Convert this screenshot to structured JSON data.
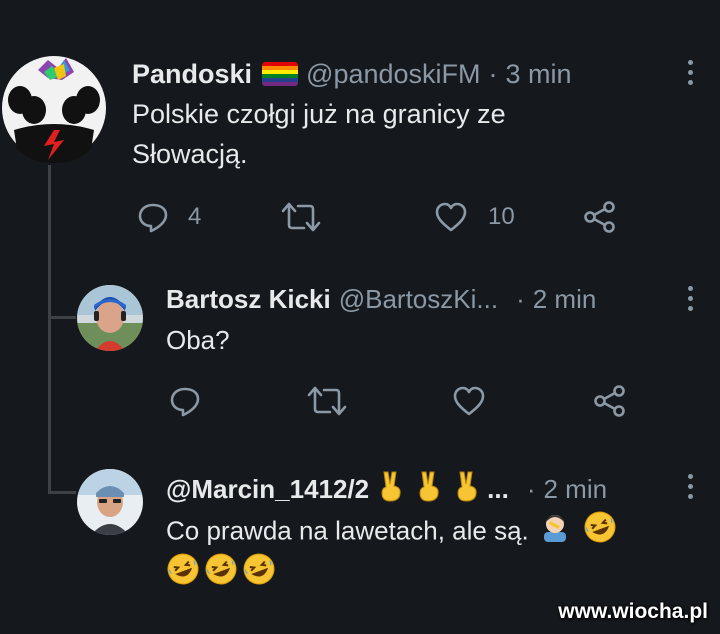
{
  "tweets": [
    {
      "name": "Pandoski",
      "handle": "@pandoskiFM",
      "separator": "·",
      "time": "3 min",
      "text_line1": "Polskie czołgi już na granicy ze",
      "text_line2": "Słowacją.",
      "reply_count": "4",
      "like_count": "10",
      "flag_icon": "rainbow-flag-icon"
    },
    {
      "name": "Bartosz Kicki",
      "handle": "@BartoszKi...",
      "separator": "·",
      "time": "2 min",
      "text": "Oba?"
    },
    {
      "name": "@Marcin_1412/2",
      "ellipsis": "...",
      "separator": "·",
      "time": "2 min",
      "text": "Co prawda na lawetach, ale są.",
      "name_emoji": [
        "victory-hand-icon",
        "victory-hand-icon",
        "victory-hand-icon"
      ],
      "text_emoji": [
        "person-facepalming-icon",
        "rolling-on-floor-laughing-icon"
      ],
      "extra_emoji": [
        "rolling-on-floor-laughing-icon",
        "rolling-on-floor-laughing-icon",
        "rolling-on-floor-laughing-icon"
      ]
    }
  ],
  "watermark": "www.wiocha.pl",
  "colors": {
    "background": "#15181c",
    "text": "#e7e9ea",
    "muted": "#8b98a5",
    "thread_line": "#3e4247",
    "emoji_yellow": "#f7c533"
  }
}
